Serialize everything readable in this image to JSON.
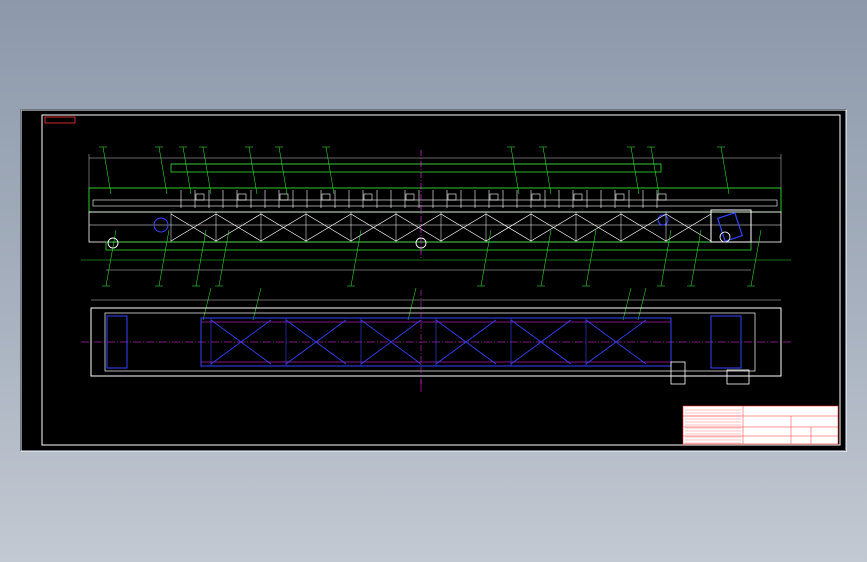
{
  "viewer": {
    "background_color": "#000000",
    "desktop_gradient": [
      "#8d99ab",
      "#c3c9d2"
    ]
  },
  "drawing": {
    "colors": {
      "frame": "#ffffff",
      "structure": "#33dd33",
      "parts": "#ffffff",
      "centerline": "#ff33ff",
      "detail": "#3344ff",
      "leader": "#33ff33",
      "dimension": "#cccccc",
      "title_bg": "#ffffff",
      "title_line": "#ff3333",
      "title_text": "#2222cc"
    },
    "corner_tag": "",
    "view_note": "",
    "title_block": {
      "title": "",
      "subtitle": "",
      "drawing_no": "",
      "material": ""
    }
  }
}
